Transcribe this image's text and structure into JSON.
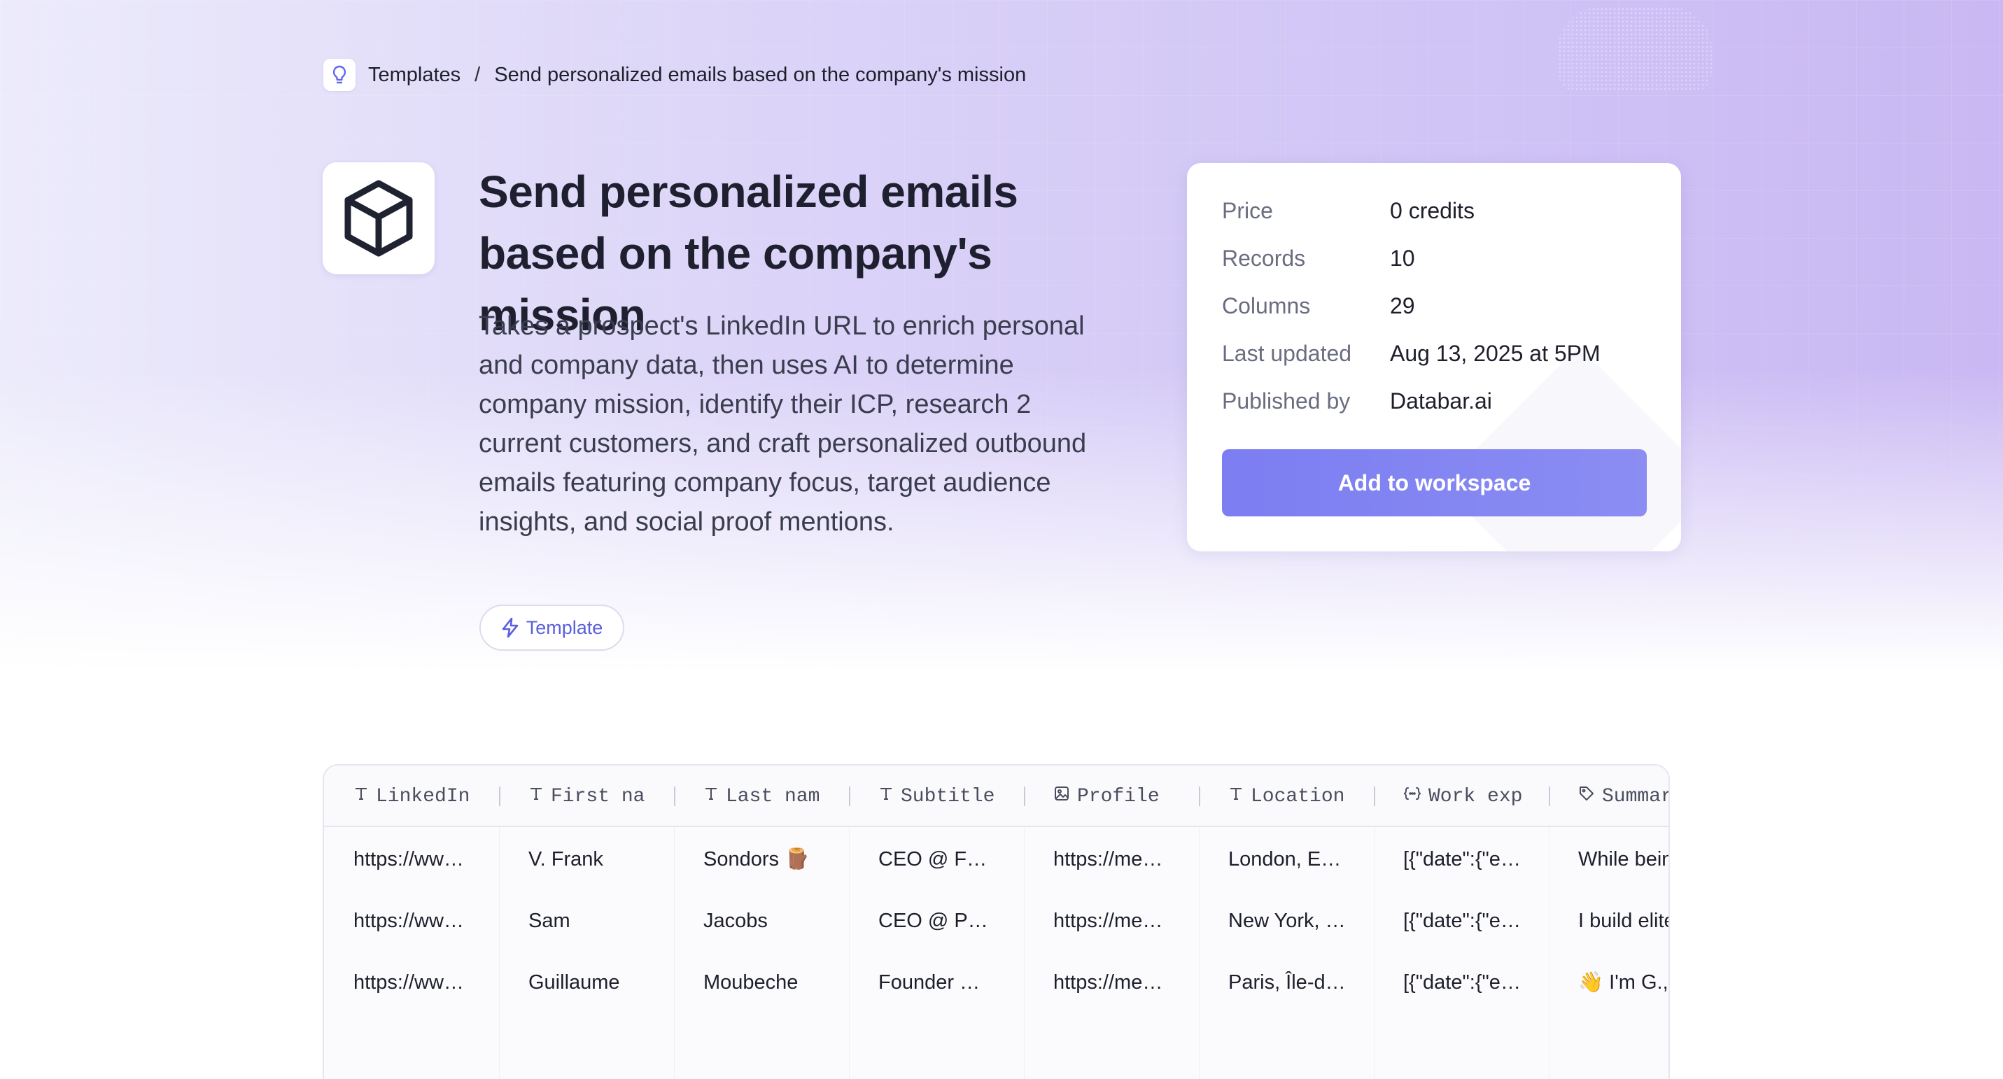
{
  "breadcrumb": {
    "icon": "lightbulb-icon",
    "root": "Templates",
    "separator": "/",
    "current": "Send personalized emails based on the company's mission"
  },
  "hero": {
    "icon": "cube-icon",
    "title": "Send personalized emails based on the company's mission",
    "description": "Takes a prospect's LinkedIn URL to enrich personal and company data, then uses AI to determine company mission, identify their ICP, research 2 current customers, and craft personalized outbound emails featuring company focus, target audience insights, and social proof mentions.",
    "tag": {
      "icon": "lightning-icon",
      "label": "Template"
    }
  },
  "info": {
    "rows": [
      {
        "label": "Price",
        "value": "0 credits"
      },
      {
        "label": "Records",
        "value": "10"
      },
      {
        "label": "Columns",
        "value": "29"
      },
      {
        "label": "Last updated",
        "value": "Aug 13, 2025 at 5PM"
      },
      {
        "label": "Published by",
        "value": "Databar.ai"
      }
    ],
    "button": "Add to workspace"
  },
  "table": {
    "columns": [
      {
        "icon": "text-type-icon",
        "label": "LinkedIn"
      },
      {
        "icon": "text-type-icon",
        "label": "First na"
      },
      {
        "icon": "text-type-icon",
        "label": "Last nam"
      },
      {
        "icon": "text-type-icon",
        "label": "Subtitle"
      },
      {
        "icon": "image-type-icon",
        "label": "Profile"
      },
      {
        "icon": "text-type-icon",
        "label": "Location"
      },
      {
        "icon": "json-type-icon",
        "label": "Work exp"
      },
      {
        "icon": "tag-type-icon",
        "label": "Summar"
      }
    ],
    "rows": [
      [
        "https://ww…",
        "V. Frank",
        "Sondors 🪵",
        "CEO @ For…",
        "https://me…",
        "London, En…",
        "[{\"date\":{\"e…",
        "While bein"
      ],
      [
        "https://ww…",
        "Sam",
        "Jacobs",
        "CEO @ Pav…",
        "https://me…",
        "New York, …",
        "[{\"date\":{\"e…",
        "I build elite"
      ],
      [
        "https://ww…",
        "Guillaume",
        "Moubeche",
        "Founder @ …",
        "https://me…",
        "Paris, Île-d…",
        "[{\"date\":{\"e…",
        "👋 I'm G.,"
      ]
    ]
  },
  "colors": {
    "accent": "#7c7df1",
    "tag_text": "#5a5fdb",
    "hero_gradient_right": "#c9b8f3"
  }
}
